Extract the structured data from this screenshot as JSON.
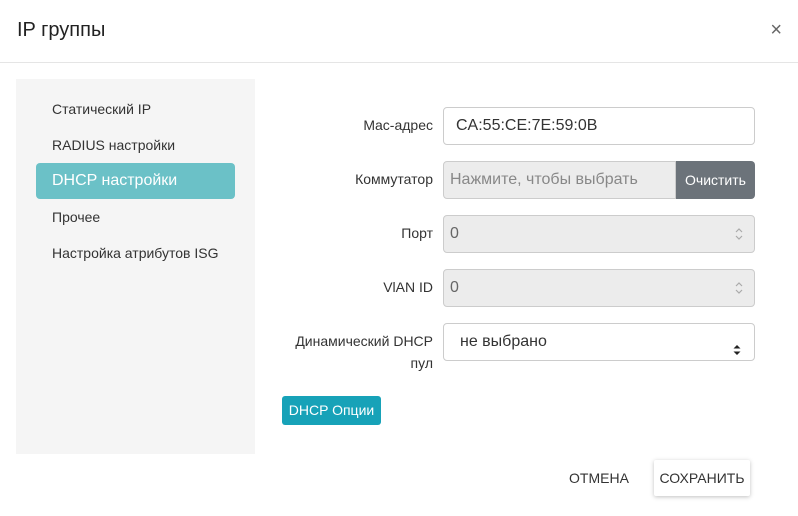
{
  "dialog": {
    "title": "IP группы",
    "close_symbol": "×"
  },
  "sidebar": {
    "items": [
      {
        "label": "Статический IP",
        "active": false
      },
      {
        "label": "RADIUS настройки",
        "active": false
      },
      {
        "label": "DHCP настройки",
        "active": true
      },
      {
        "label": "Прочее",
        "active": false
      },
      {
        "label": "Настройка атрибутов ISG",
        "active": false
      }
    ]
  },
  "form": {
    "mac": {
      "label": "Mac-адрес",
      "value": "CA:55:CE:7E:59:0B"
    },
    "switch": {
      "label": "Коммутатор",
      "placeholder": "Нажмите, чтобы выбрать",
      "clear_label": "Очистить"
    },
    "port": {
      "label": "Порт",
      "value": "0"
    },
    "vlan": {
      "label": "VlAN ID",
      "value": "0"
    },
    "dhcp_pool": {
      "label_line1": "Динамический DHCP",
      "label_line2": "пул",
      "value": "не выбрано"
    },
    "dhcp_options_label": "DHCP Опции"
  },
  "footer": {
    "cancel_label": "ОТМЕНА",
    "save_label": "СОХРАНИТЬ"
  },
  "colors": {
    "accent_active": "#6bc1c7",
    "info_button": "#17a2b8",
    "clear_button": "#6c737a"
  },
  "icons": [
    "close-icon",
    "spinner-icon",
    "select-arrow-icon"
  ]
}
